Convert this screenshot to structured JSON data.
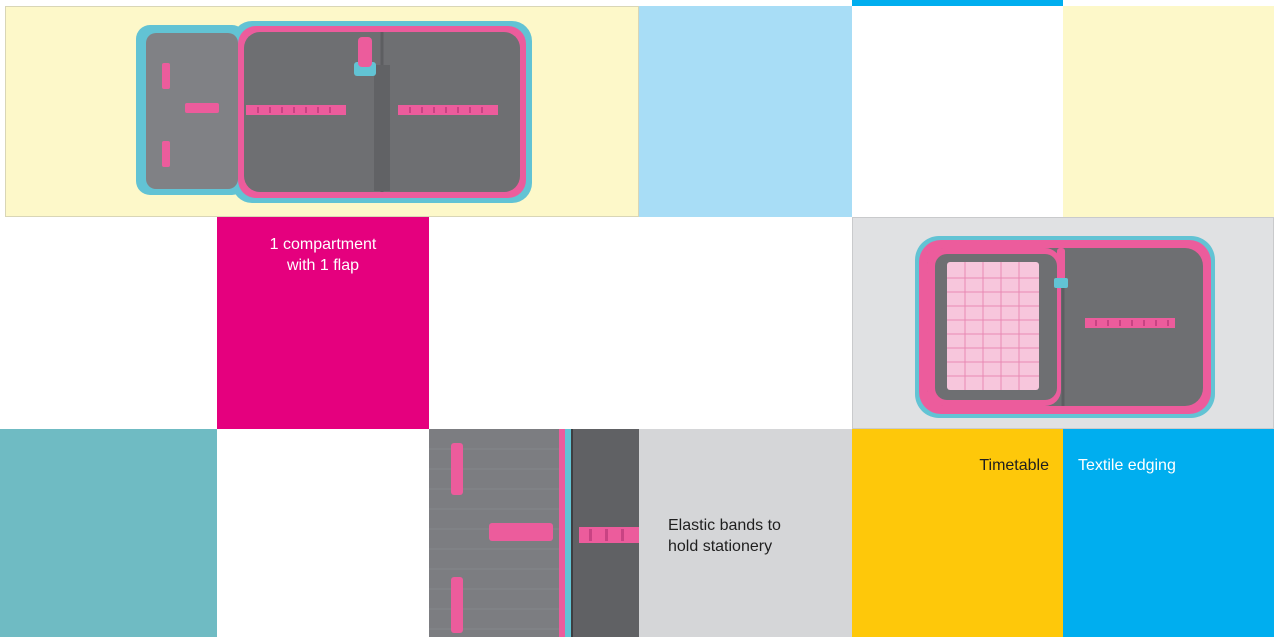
{
  "captions": {
    "one_compartment": "1 compartment\nwith 1 flap",
    "elastic_bands": "Elastic bands to\nhold stationery",
    "timetable": "Timetable",
    "textile_edging": "Textile edging"
  },
  "colors": {
    "cream": "#fdf8c9",
    "light_blue": "#a8ddf6",
    "magenta": "#e5007e",
    "teal": "#6fbbc3",
    "light_grey": "#d5d6d8",
    "yellow": "#fec80a",
    "cyan": "#00aeef",
    "case_grey": "#6e6f72",
    "case_pink": "#ec5c9c",
    "case_turquoise": "#62c3d4"
  },
  "images": {
    "open_case": "pencil-case-open-two-panels",
    "flap_closeup": "pencil-case-flap-closeup",
    "timetable_case": "pencil-case-with-timetable"
  }
}
